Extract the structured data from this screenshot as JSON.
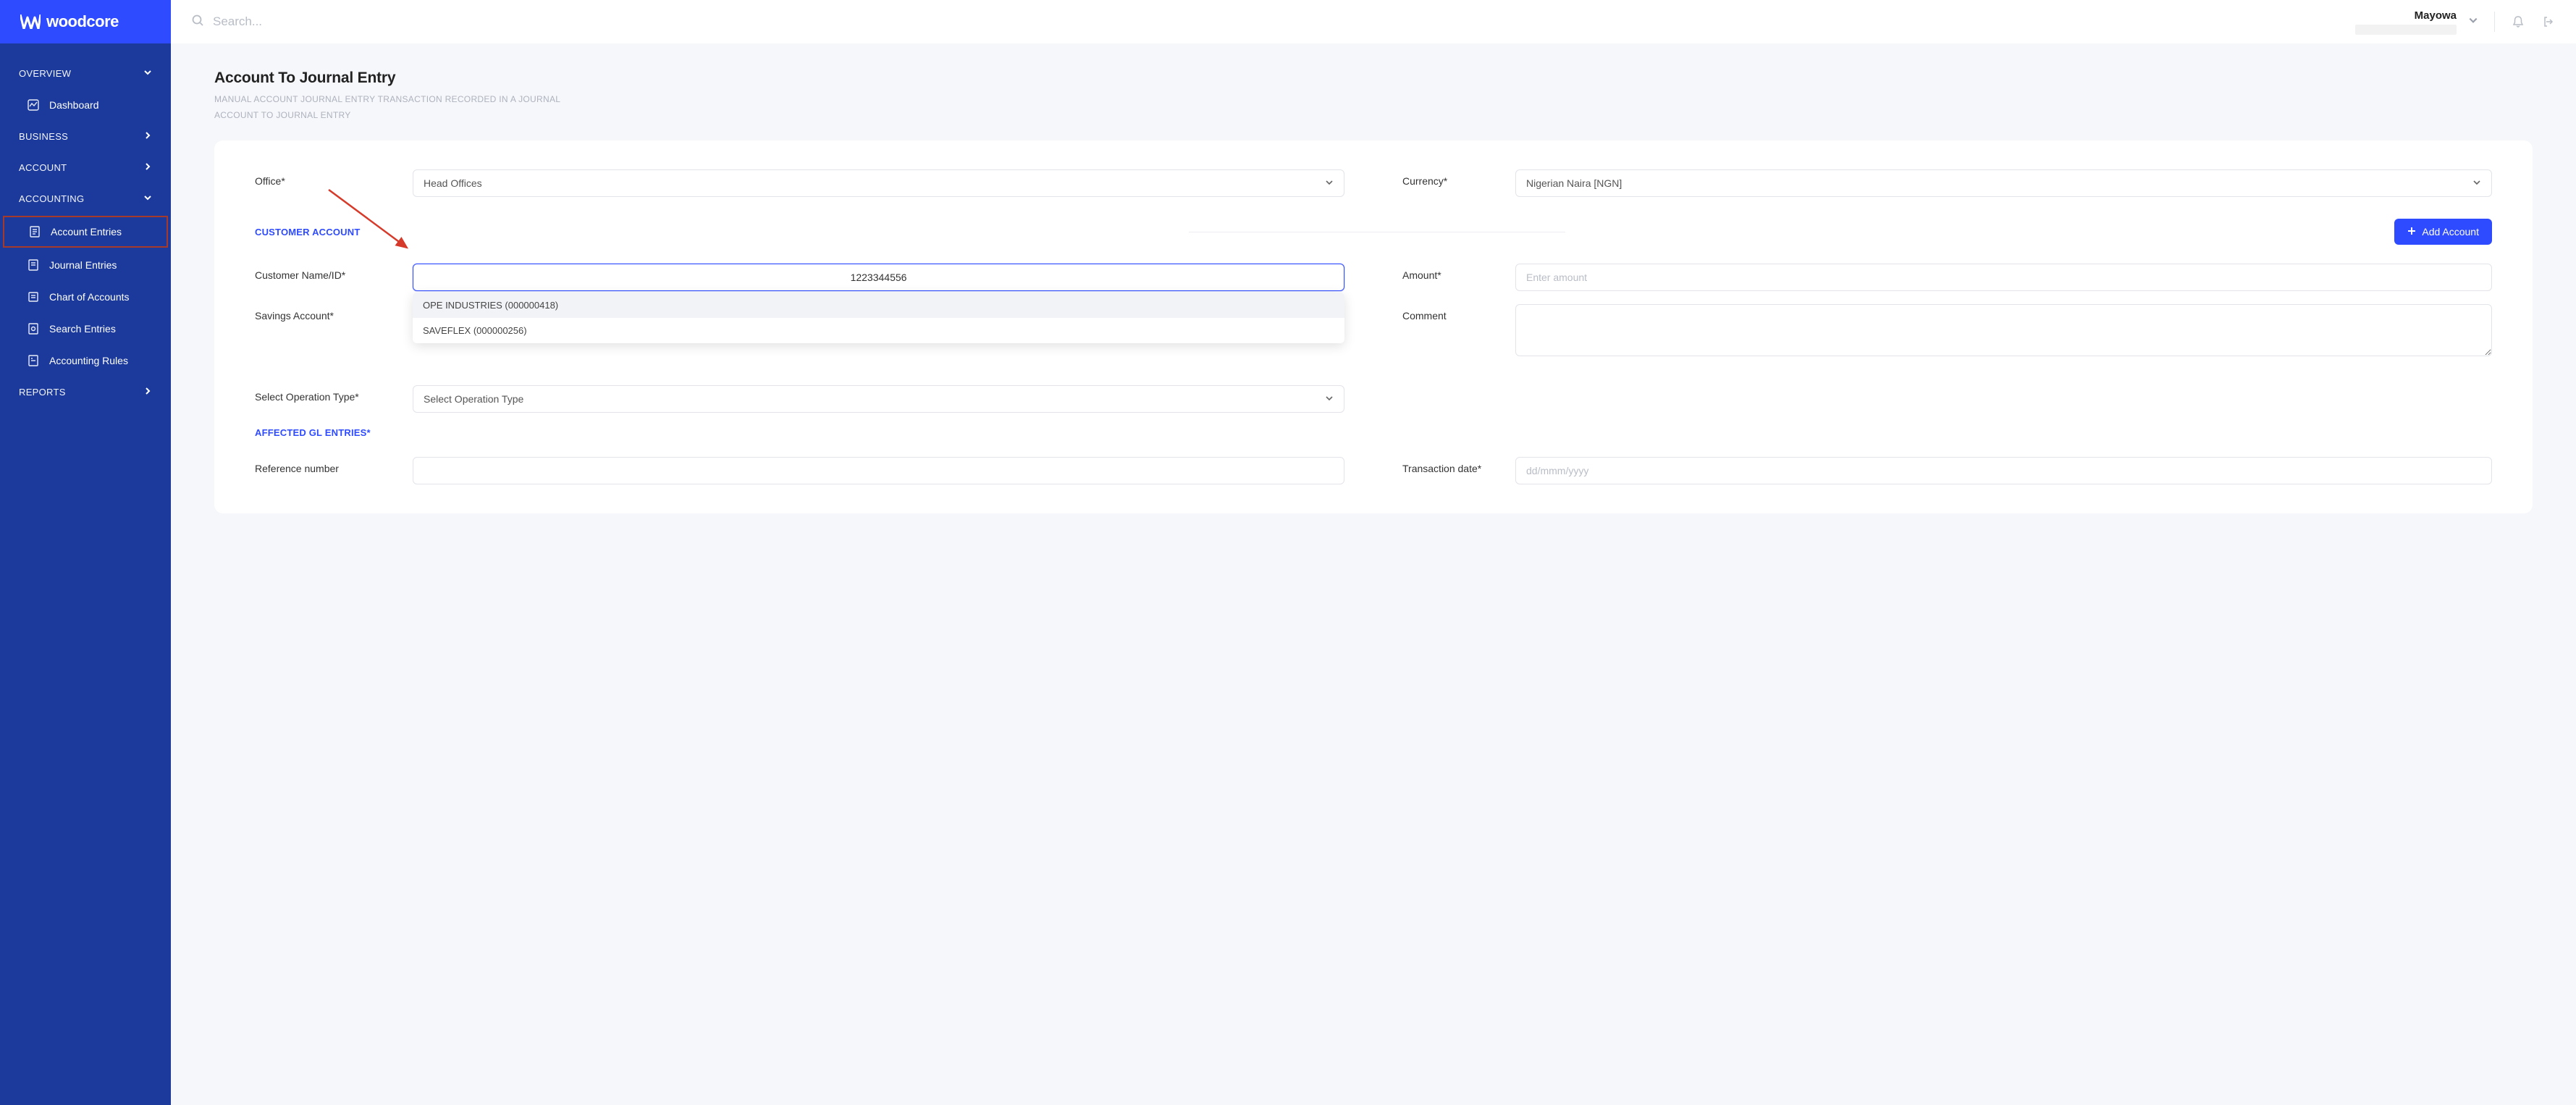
{
  "brand": "woodcore",
  "search": {
    "placeholder": "Search..."
  },
  "user": {
    "name": "Mayowa"
  },
  "sidebar": {
    "sections": [
      {
        "label": "OVERVIEW",
        "expanded": true
      },
      {
        "label": "BUSINESS",
        "expanded": false
      },
      {
        "label": "ACCOUNT",
        "expanded": false
      },
      {
        "label": "ACCOUNTING",
        "expanded": true
      },
      {
        "label": "REPORTS",
        "expanded": false
      }
    ],
    "overview_items": [
      {
        "label": "Dashboard"
      }
    ],
    "accounting_items": [
      {
        "label": "Account Entries",
        "active": true
      },
      {
        "label": "Journal Entries"
      },
      {
        "label": "Chart of Accounts"
      },
      {
        "label": "Search Entries"
      },
      {
        "label": "Accounting Rules"
      }
    ]
  },
  "page": {
    "title": "Account To Journal Entry",
    "subtitle": "MANUAL ACCOUNT JOURNAL ENTRY TRANSACTION RECORDED IN A JOURNAL",
    "breadcrumb": "ACCOUNT TO JOURNAL ENTRY"
  },
  "form": {
    "office_label": "Office*",
    "office_value": "Head Offices",
    "currency_label": "Currency*",
    "currency_value": "Nigerian Naira [NGN]",
    "customer_section": "CUSTOMER ACCOUNT",
    "add_account_btn": "Add Account",
    "customer_name_label": "Customer Name/ID*",
    "customer_name_value": "1223344556",
    "customer_options": [
      "OPE INDUSTRIES (000000418)",
      "SAVEFLEX (000000256)"
    ],
    "savings_label": "Savings Account*",
    "amount_label": "Amount*",
    "amount_placeholder": "Enter amount",
    "comment_label": "Comment",
    "operation_label": "Select Operation Type*",
    "operation_value": "Select Operation Type",
    "gl_section": "AFFECTED GL ENTRIES*",
    "reference_label": "Reference number",
    "txn_date_label": "Transaction date*",
    "txn_date_placeholder": "dd/mmm/yyyy"
  }
}
